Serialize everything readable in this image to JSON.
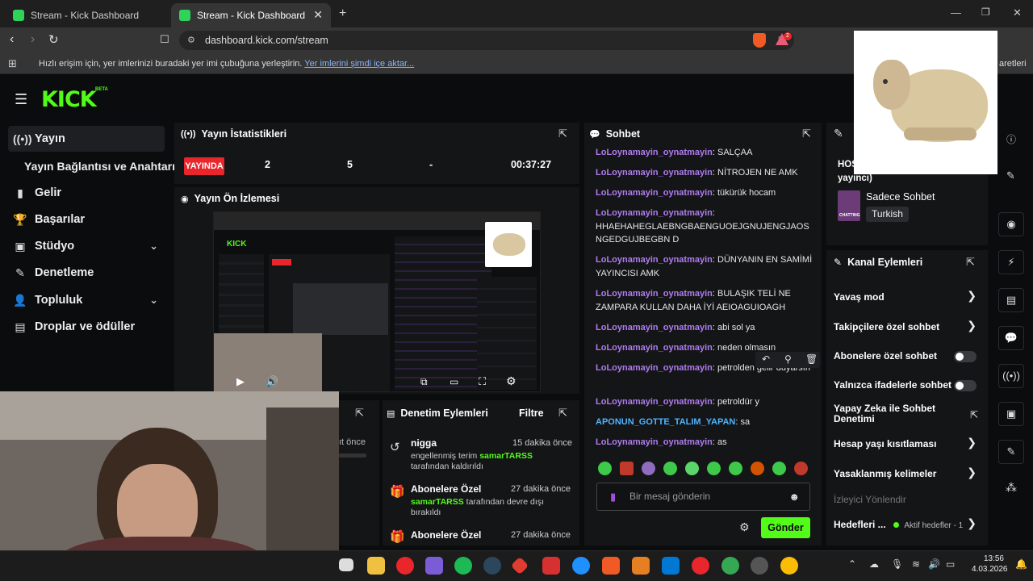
{
  "browser": {
    "tabs": [
      {
        "title": "Stream - Kick Dashboard"
      },
      {
        "title": "Stream - Kick Dashboard"
      }
    ],
    "url": "dashboard.kick.com/stream",
    "bookmarks_text": "Hızlı erişim için, yer imlerinizi buradaki yer imi çubuğuna yerleştirin.",
    "bookmarks_link": "Yer imlerini şimdi içe aktar...",
    "bookmarks_right": "aretleri",
    "ext_badge": "2"
  },
  "header": {
    "logo": "KICK",
    "beta": "BETA"
  },
  "sidebar": {
    "items": [
      {
        "label": "Yayın",
        "icon": "broadcast-icon"
      },
      {
        "label": "Yayın Bağlantısı ve Anahtarı",
        "icon": ""
      },
      {
        "label": "Gelir",
        "icon": "chart-icon"
      },
      {
        "label": "Başarılar",
        "icon": "trophy-icon"
      },
      {
        "label": "Stüdyo",
        "icon": "studio-icon"
      },
      {
        "label": "Denetleme",
        "icon": "wrench-icon"
      },
      {
        "label": "Topluluk",
        "icon": "community-icon"
      },
      {
        "label": "Droplar ve ödüller",
        "icon": "drops-icon"
      }
    ]
  },
  "stats": {
    "title": "Yayın İstatistikleri",
    "live_badge": "YAYINDA",
    "viewers": "2",
    "followers": "5",
    "subs": "-",
    "uptime": "00:37:27"
  },
  "preview": {
    "title": "Yayın Ön İzlemesi"
  },
  "mod_actions": {
    "title": "Denetim Eylemleri",
    "filter": "Filtre",
    "left_time": "ıt önce",
    "items": [
      {
        "title": "nigga",
        "time": "15 dakika önce",
        "line1": "engellenmiş terim",
        "user": "samarTARSS",
        "line2": "tarafından kaldırıldı"
      },
      {
        "title": "Abonelere Özel",
        "time": "27 dakika önce",
        "user": "samarTARSS",
        "line1": "tarafından devre dışı",
        "line2": "bırakıldı"
      },
      {
        "title": "Abonelere Özel",
        "time": "27 dakika önce"
      }
    ]
  },
  "chat": {
    "title": "Sohbet",
    "messages": [
      {
        "user": "LoLoynamayin_oynatmayin",
        "text": "SALÇAA"
      },
      {
        "user": "LoLoynamayin_oynatmayin",
        "text": "NİTROJEN NE AMK"
      },
      {
        "user": "LoLoynamayin_oynatmayin",
        "text": "tükürük hocam"
      },
      {
        "user": "LoLoynamayin_oynatmayin",
        "text": "HHAEHAHEGLAEBNGBAENGUOEJGNUJENGJAOS NGEDGUJBEGBN D"
      },
      {
        "user": "LoLoynamayin_oynatmayin",
        "text": "DÜNYANIN EN SAMİMİ YAYINCISI AMK"
      },
      {
        "user": "LoLoynamayin_oynatmayin",
        "text": "BULAŞIK TELİ NE ZAMPARA KULLAN DAHA İYİ AEIOAGUIOAGH"
      },
      {
        "user": "LoLoynamayin_oynatmayin",
        "text": "abi sol ya"
      },
      {
        "user": "LoLoynamayin_oynatmayin",
        "text": "neden olmasın"
      },
      {
        "user": "LoLoynamayin_oynatmayin",
        "text": "petrolden gelir duyarsın"
      },
      {
        "user": "LoLoynamayin_oynatmayin",
        "text": "petroldür y"
      },
      {
        "user": "APONUN_GOTTE_TALIM_YAPAN",
        "text": "sa"
      },
      {
        "user": "LoLoynamayin_oynatmayin",
        "text": "as"
      }
    ],
    "placeholder": "Bir mesaj gönderin",
    "send": "Gönder"
  },
  "stream_info": {
    "title_partial": "HOŞ",
    "subtitle_partial": "yayıncı)",
    "category": "Sadece Sohbet",
    "tag": "Turkish",
    "thumb_label": "CHATTING"
  },
  "channel_actions": {
    "title": "Kanal Eylemleri",
    "items": [
      {
        "label": "Yavaş mod",
        "kind": "arrow"
      },
      {
        "label": "Takipçilere özel sohbet",
        "kind": "arrow"
      },
      {
        "label": "Abonelere özel sohbet",
        "kind": "toggle"
      },
      {
        "label": "Yalnızca ifadelerle sohbet",
        "kind": "toggle"
      },
      {
        "label": "Yapay Zeka ile Sohbet Denetimi",
        "kind": "external"
      },
      {
        "label": "Hesap yaşı kısıtlaması",
        "kind": "arrow"
      },
      {
        "label": "Yasaklanmış kelimeler",
        "kind": "arrow"
      }
    ],
    "section_viewer": "İzleyici Yönlendir",
    "goals_label": "Hedefleri ...",
    "goals_status": "Aktif hedefler - 1"
  },
  "taskbar": {
    "time": "13:56",
    "date": "4.03.2026"
  },
  "colors": {
    "kick_green": "#53fc18",
    "live_red": "#e8262b",
    "username_purple": "#b07cf0",
    "username_blue": "#4fb4ff"
  }
}
